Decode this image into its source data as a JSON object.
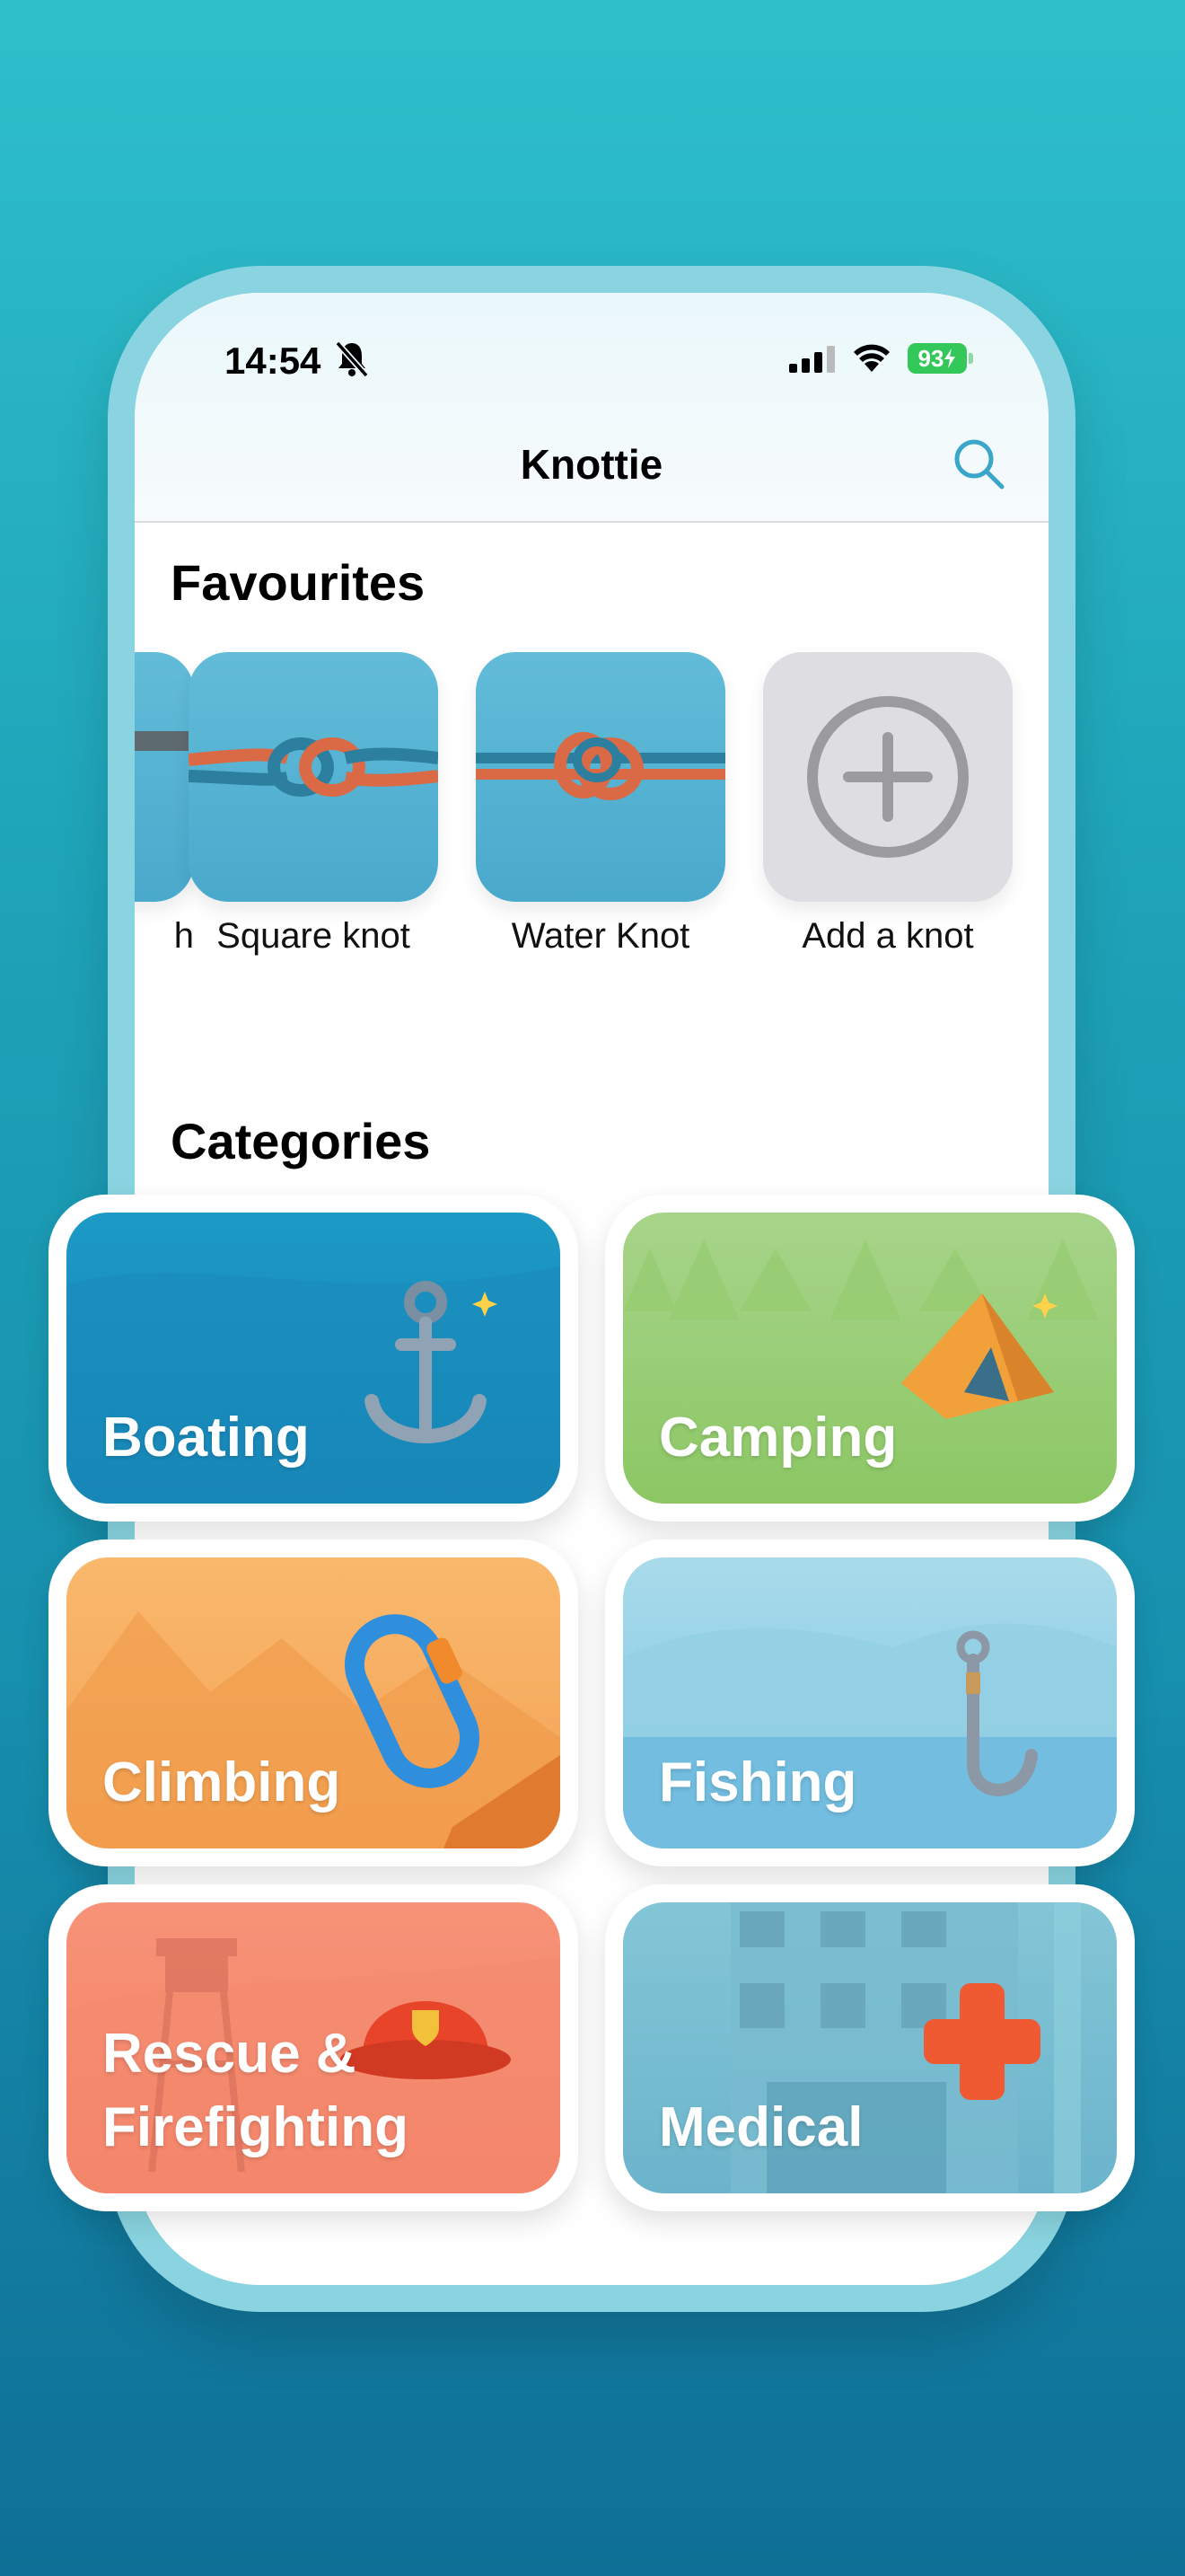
{
  "status_bar": {
    "time": "14:54",
    "battery": "93"
  },
  "app": {
    "title": "Knottie"
  },
  "favourites": {
    "title": "Favourites",
    "items": [
      {
        "label": "h",
        "icon": "knot-thumbnail-icon"
      },
      {
        "label": "Square knot",
        "icon": "square-knot-icon"
      },
      {
        "label": "Water Knot",
        "icon": "water-knot-icon"
      },
      {
        "label": "Add a knot",
        "icon": "add-circle-icon"
      }
    ]
  },
  "categories": {
    "title": "Categories",
    "items": [
      {
        "label": "Boating",
        "icon": "anchor-icon",
        "color": "#1a8fbf"
      },
      {
        "label": "Camping",
        "icon": "tent-icon",
        "color": "#8cc764"
      },
      {
        "label": "Climbing",
        "icon": "carabiner-icon",
        "color": "#f6a95c"
      },
      {
        "label": "Fishing",
        "icon": "fishing-hook-icon",
        "color": "#7cc6e6"
      },
      {
        "label": "Rescue &\nFirefighting",
        "icon": "firefighter-helmet-icon",
        "color": "#f47f66"
      },
      {
        "label": "Medical",
        "icon": "medical-cross-icon",
        "color": "#6cb4cc"
      }
    ]
  },
  "colors": {
    "accent": "#3aa6c9",
    "battery": "#34c759"
  }
}
